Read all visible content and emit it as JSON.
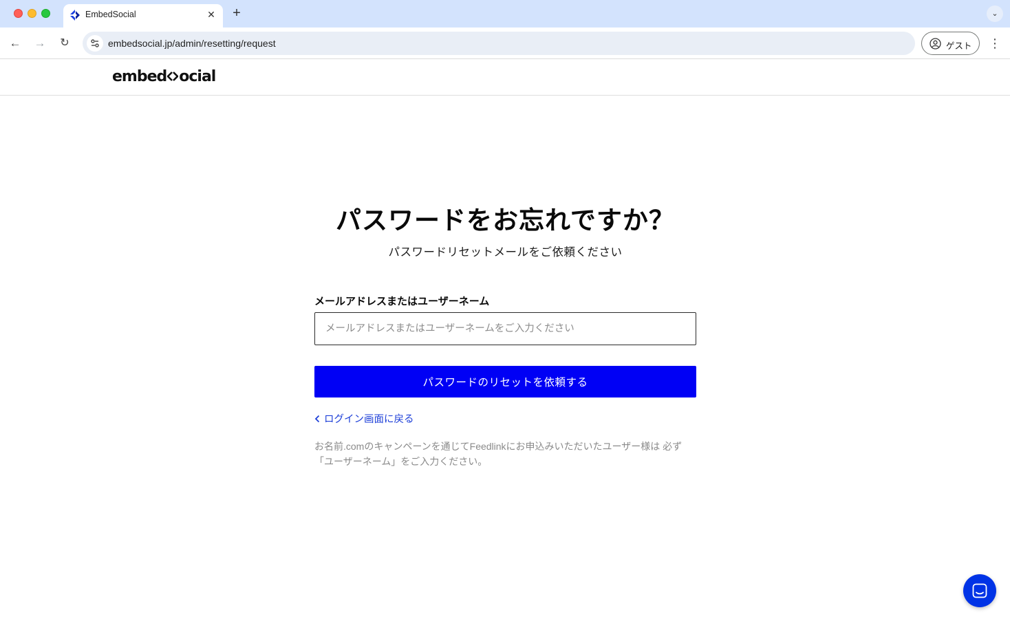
{
  "browser": {
    "tab_title": "EmbedSocial",
    "url": "embedsocial.jp/admin/resetting/request",
    "profile_label": "ゲスト"
  },
  "header": {
    "logo_text_left": "embed",
    "logo_text_right": "ocial"
  },
  "form": {
    "title": "パスワードをお忘れですか？",
    "subtitle": "パスワードリセットメールをご依頼ください",
    "field_label": "メールアドレスまたはユーザーネーム",
    "field_placeholder": "メールアドレスまたはユーザーネームをご入力ください",
    "field_value": "",
    "submit_label": "パスワードのリセットを依頼する",
    "back_link_label": "ログイン画面に戻る",
    "note_line1": "お名前.comのキャンペーンを通じてFeedlinkにお申込みいただいたユーザー様は 必ず",
    "note_line2": "「ユーザーネーム」をご入力ください。"
  },
  "colors": {
    "primary_button": "#0000f5",
    "link": "#1d3fd8",
    "chat_button": "#0033e6",
    "tabbar": "#d3e3fd"
  },
  "icons": [
    "embedsocial-favicon",
    "close-icon",
    "plus-icon",
    "chevron-down-icon",
    "back-arrow-icon",
    "forward-arrow-icon",
    "reload-icon",
    "site-info-icon",
    "profile-icon",
    "kebab-menu-icon",
    "chevron-left-icon",
    "chat-icon"
  ]
}
